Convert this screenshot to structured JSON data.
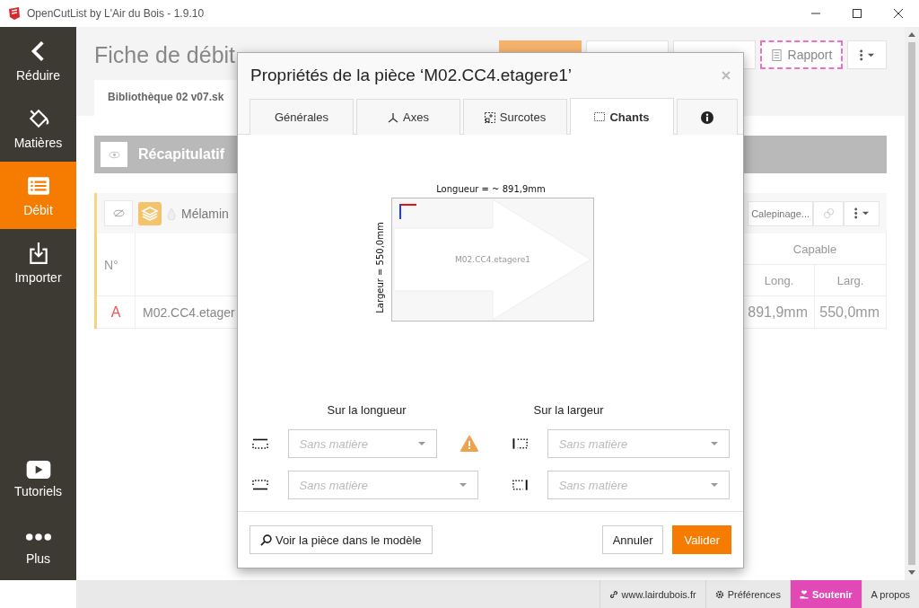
{
  "window": {
    "title": "OpenCutList by L'Air du Bois - 1.9.10"
  },
  "sidebar": {
    "items": [
      {
        "label": "Réduire",
        "kind": "back",
        "selected": false
      },
      {
        "label": "Matières",
        "kind": "materials",
        "selected": false
      },
      {
        "label": "Débit",
        "kind": "cutlist",
        "selected": true
      },
      {
        "label": "Importer",
        "kind": "import",
        "selected": false
      }
    ],
    "bottom_items": [
      {
        "label": "Tutoriels",
        "kind": "video",
        "selected": false
      },
      {
        "label": "Plus",
        "kind": "more",
        "selected": false
      }
    ]
  },
  "page": {
    "title": "Fiche de débit",
    "toolbar": [
      {
        "kind": "primary"
      },
      {
        "kind": "plain"
      },
      {
        "kind": "plain"
      },
      {
        "kind": "report",
        "label": "Rapport"
      },
      {
        "kind": "menu"
      }
    ],
    "file_tab": "Bibliothèque 02 v07.sk",
    "summary": {
      "label": "Récapitulatif"
    },
    "group": {
      "material": "Mélamin",
      "action": "Calepinage..."
    },
    "table": {
      "first_column": "N°",
      "capable": "Capable",
      "subcolumns": [
        "Long.",
        "Larg."
      ],
      "rows": [
        {
          "id": "A",
          "name": "M02.CC4.etager",
          "length": "891,9mm",
          "width": "550,0mm"
        }
      ]
    }
  },
  "dialog": {
    "title": "Propriétés de la pièce ‘M02.CC4.etagere1’",
    "tabs": [
      {
        "kind": "general",
        "label": "Générales",
        "selected": false
      },
      {
        "kind": "axes",
        "label": "Axes",
        "selected": false
      },
      {
        "kind": "oversize",
        "label": "Surcotes",
        "selected": false
      },
      {
        "kind": "edges",
        "label": "Chants",
        "selected": true
      },
      {
        "kind": "info",
        "selected": false
      }
    ],
    "diagram": {
      "length_label": "Longueur = ~ 891,9mm",
      "width_label": "Largeur = 550,0mm",
      "part_name": "M02.CC4.etagere1"
    },
    "edges": {
      "length_heading": "Sur la longueur",
      "width_heading": "Sur la largeur",
      "fields": [
        {
          "kind": "top",
          "placeholder": "Sans matière",
          "warning": true
        },
        {
          "kind": "left",
          "placeholder": "Sans matière",
          "warning": false
        },
        {
          "kind": "bottom",
          "placeholder": "Sans matière",
          "warning": false
        },
        {
          "kind": "right",
          "placeholder": "Sans matière",
          "warning": false
        }
      ]
    },
    "footer": {
      "locate_button": "Voir la pièce dans le modèle",
      "cancel": "Annuler",
      "confirm": "Valider"
    }
  },
  "status_bar": [
    {
      "kind": "link",
      "label": "www.lairdubois.fr"
    },
    {
      "kind": "settings",
      "label": "Préférences"
    },
    {
      "kind": "donate",
      "label": "Soutenir"
    },
    {
      "kind": "plain",
      "label": "A propos"
    }
  ]
}
